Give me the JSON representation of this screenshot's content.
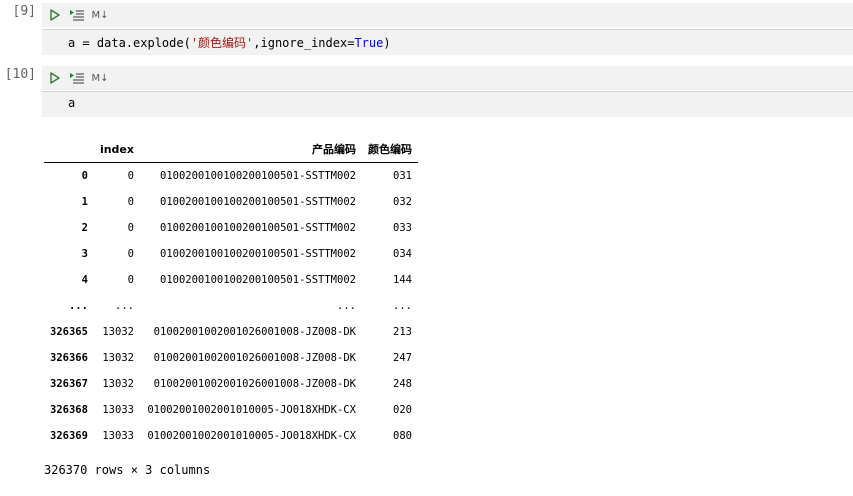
{
  "cells": [
    {
      "prompt": "[9]",
      "md_label": "M↓",
      "code": {
        "prefix": "a = data.explode(",
        "str": "'颜色编码'",
        "mid": ",ignore_index=",
        "kw": "True",
        "suffix": ")"
      }
    },
    {
      "prompt": "[10]",
      "md_label": "M↓",
      "code": {
        "prefix": "a"
      }
    }
  ],
  "table": {
    "columns": [
      "",
      "index",
      "产品编码",
      "颜色编码"
    ],
    "rows": [
      [
        "0",
        "0",
        "010020010010020010050​1-SSTTM002",
        "031"
      ],
      [
        "1",
        "0",
        "010020010010020010050​1-SSTTM002",
        "032"
      ],
      [
        "2",
        "0",
        "010020010010020010050​1-SSTTM002",
        "033"
      ],
      [
        "3",
        "0",
        "010020010010020010050​1-SSTTM002",
        "034"
      ],
      [
        "4",
        "0",
        "010020010010020010050​1-SSTTM002",
        "144"
      ],
      [
        "...",
        "...",
        "...",
        "..."
      ],
      [
        "326365",
        "13032",
        "01002001002001026001008-JZ008-DK",
        "213"
      ],
      [
        "326366",
        "13032",
        "01002001002001026001008-JZ008-DK",
        "247"
      ],
      [
        "326367",
        "13032",
        "01002001002001026001008-JZ008-DK",
        "248"
      ],
      [
        "326368",
        "13033",
        "01002001002001010005-JO018XHDK-CX",
        "020"
      ],
      [
        "326369",
        "13033",
        "01002001002001010005-JO018XHDK-CX",
        "080"
      ]
    ]
  },
  "shape_text": "326370 rows × 3 columns",
  "colors": {
    "run_icon": "#2e7d32",
    "toolbar_bg": "#f2f2f2",
    "string": "#a31515",
    "keyword": "#0000ff"
  },
  "icons": [
    "run-icon",
    "run-below-icon",
    "markdown-toggle"
  ]
}
